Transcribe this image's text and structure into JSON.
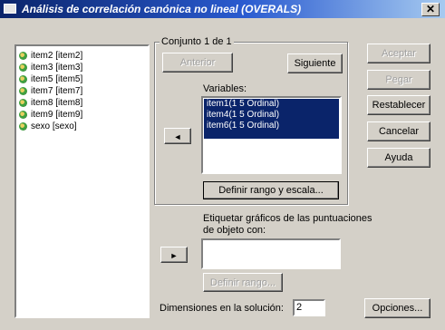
{
  "window": {
    "title": "Análisis de correlación canónica no lineal (OVERALS)",
    "close_glyph": "✕"
  },
  "source_list": {
    "items": [
      {
        "label": "item2 [item2]"
      },
      {
        "label": "item3 [item3]"
      },
      {
        "label": "item5 [item5]"
      },
      {
        "label": "item7 [item7]"
      },
      {
        "label": "item8 [item8]"
      },
      {
        "label": "item9 [item9]"
      },
      {
        "label": "sexo [sexo]"
      }
    ]
  },
  "set_group": {
    "title": "Conjunto 1 de 1",
    "prev_label": "Anterior",
    "next_label": "Siguiente",
    "variables_label": "Variables:",
    "variables": [
      {
        "label": "item1(1 5 Ordinal)"
      },
      {
        "label": "item4(1 5 Ordinal)"
      },
      {
        "label": "item6(1 5 Ordinal)"
      }
    ],
    "move_arrow": "◄",
    "define_range_scale_label": "Definir rango y escala..."
  },
  "object_scores": {
    "label": "Etiquetar gráficos de las puntuaciones de objeto con:",
    "move_arrow": "►",
    "define_range_label": "Definir rango...",
    "value": ""
  },
  "dimensions": {
    "label": "Dimensiones en la solución:",
    "value": "2"
  },
  "buttons": {
    "accept": "Aceptar",
    "paste": "Pegar",
    "reset": "Restablecer",
    "cancel": "Cancelar",
    "help": "Ayuda",
    "options": "Opciones..."
  }
}
